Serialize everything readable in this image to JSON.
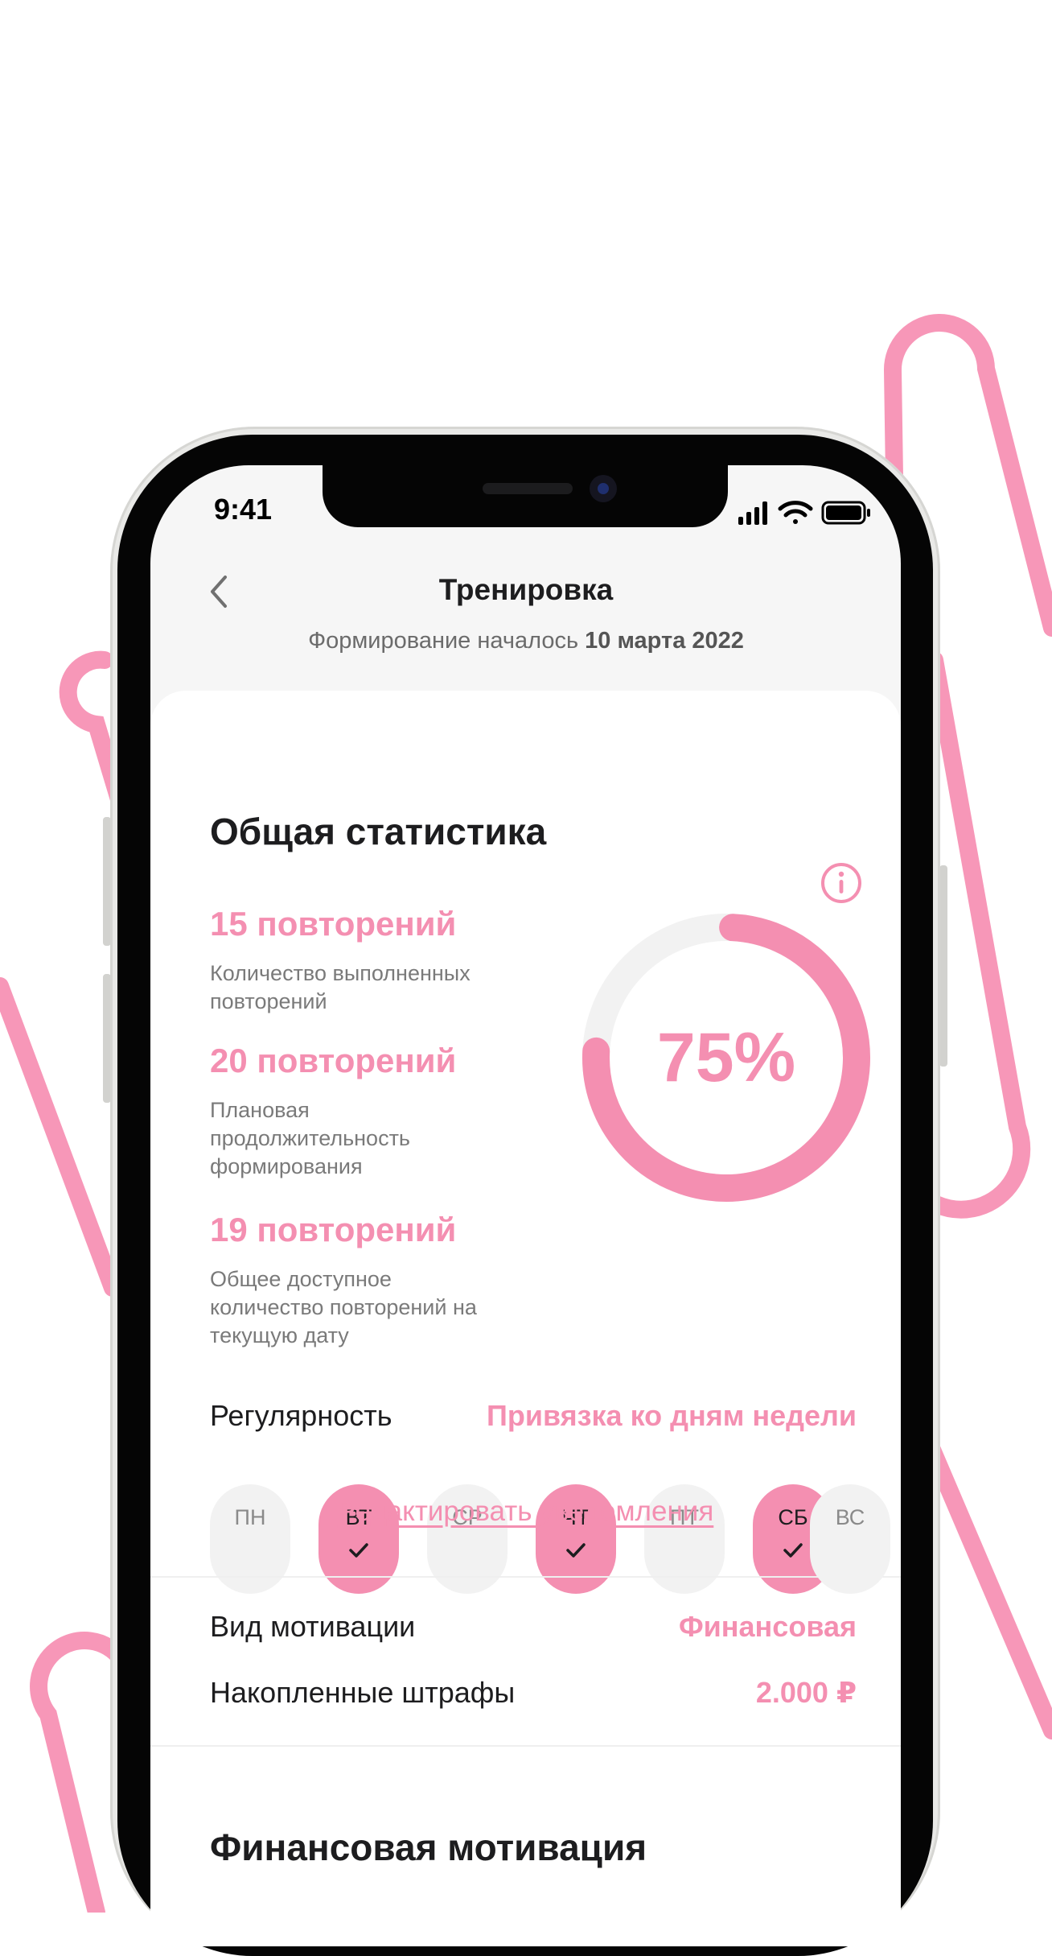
{
  "status_bar": {
    "time": "9:41"
  },
  "header": {
    "title": "Тренировка",
    "subtitle_prefix": "Формирование началось",
    "subtitle_date": "10 марта 2022"
  },
  "stats": {
    "title": "Общая статистика",
    "items": [
      {
        "value": "15",
        "unit": "повторений",
        "desc": "Количество выполненных повторений"
      },
      {
        "value": "20",
        "unit": "повторений",
        "desc": "Плановая продолжительность формирования"
      },
      {
        "value": "19",
        "unit": "повторений",
        "desc": "Общее доступное количество повторений на текущую дату"
      }
    ],
    "progress_label": "75%",
    "progress_fraction": 0.75
  },
  "regularity": {
    "label": "Регулярность",
    "value": "Привязка ко дням недели",
    "days": [
      {
        "label": "ПН",
        "active": false
      },
      {
        "label": "ВТ",
        "active": true
      },
      {
        "label": "СР",
        "active": false
      },
      {
        "label": "ЧТ",
        "active": true
      },
      {
        "label": "ПТ",
        "active": false
      },
      {
        "label": "СБ",
        "active": true
      },
      {
        "label": "ВС",
        "active": false
      }
    ],
    "edit_link": "Редактировать уведомления"
  },
  "motivation": {
    "type_label": "Вид мотивации",
    "type_value": "Финансовая",
    "penalties_label": "Накопленные штрафы",
    "penalties_value": "2.000 ₽"
  },
  "financial": {
    "title": "Финансовая мотивация"
  },
  "colors": {
    "accent": "#f48fb1",
    "track": "#f2f2f2",
    "text": "#1d1d1f",
    "muted": "#7a7a7a"
  }
}
